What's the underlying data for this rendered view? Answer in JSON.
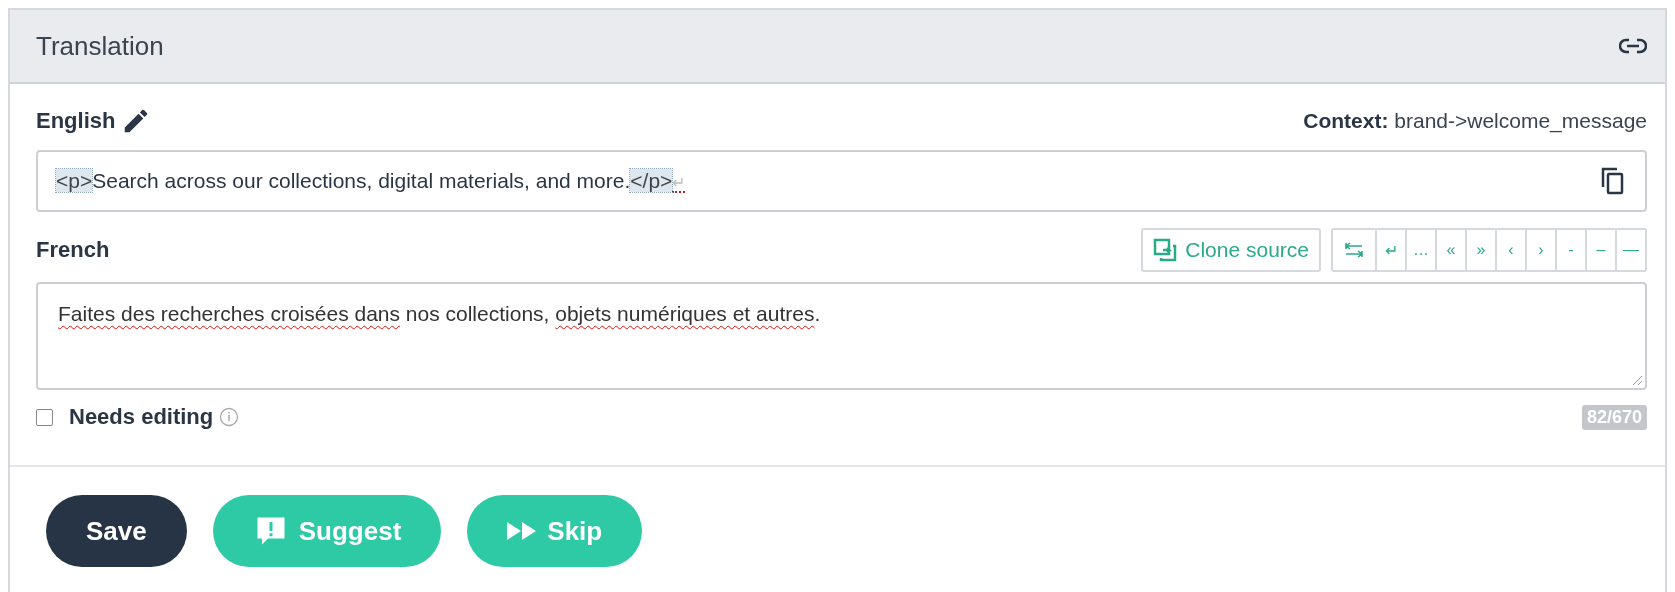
{
  "panel": {
    "title": "Translation"
  },
  "source": {
    "language": "English",
    "context_label": "Context:",
    "context_value": "brand->welcome_message",
    "segments": [
      {
        "kind": "tag",
        "text": "<p>"
      },
      {
        "kind": "text",
        "text": "Search across our collections, digital materials, and more."
      },
      {
        "kind": "tag",
        "text": "</p>"
      },
      {
        "kind": "newline",
        "text": "↵"
      }
    ]
  },
  "target": {
    "language": "French",
    "clone_button": "Clone source",
    "special_chars": [
      {
        "kind": "tab"
      },
      {
        "kind": "char",
        "text": "↵"
      },
      {
        "kind": "char",
        "text": "…"
      },
      {
        "kind": "char",
        "text": "«"
      },
      {
        "kind": "char",
        "text": "»"
      },
      {
        "kind": "char",
        "text": "‹"
      },
      {
        "kind": "char",
        "text": "›"
      },
      {
        "kind": "char",
        "text": "-"
      },
      {
        "kind": "char",
        "text": "–"
      },
      {
        "kind": "char",
        "text": "—"
      }
    ],
    "segments": [
      {
        "text": "Faites des recherches croisées dans",
        "misspelled": true
      },
      {
        "text": " nos collections, ",
        "misspelled": false
      },
      {
        "text": "objets numériques et autres",
        "misspelled": true
      }
    ],
    "segments_end": ".",
    "needs_editing": {
      "label": "Needs editing",
      "checked": false
    },
    "counter": "82/670"
  },
  "actions": [
    {
      "kind": "save",
      "label": "Save"
    },
    {
      "kind": "suggest",
      "label": "Suggest"
    },
    {
      "kind": "skip",
      "label": "Skip"
    }
  ]
}
